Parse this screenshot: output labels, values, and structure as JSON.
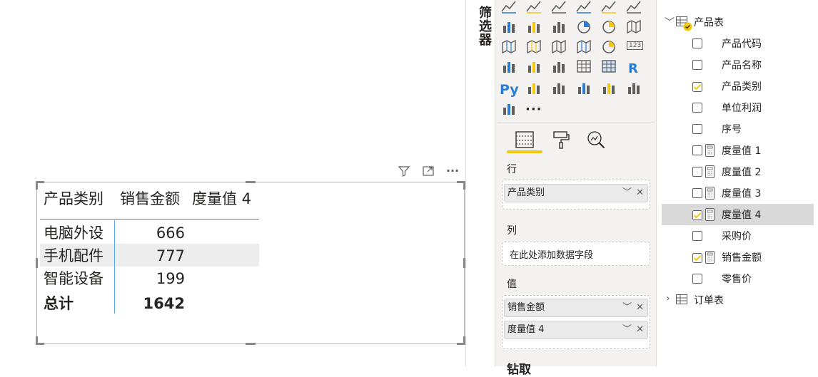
{
  "matrix": {
    "headers": [
      "产品类别",
      "销售金额",
      "度量值 4"
    ],
    "rows": [
      {
        "category": "电脑外设",
        "sales": "666"
      },
      {
        "category": "手机配件",
        "sales": "777"
      },
      {
        "category": "智能设备",
        "sales": "199"
      }
    ],
    "total": {
      "label": "总计",
      "sales": "1642"
    }
  },
  "visual_header": {
    "icons": [
      "filter-icon",
      "focus-mode-icon",
      "more-options-icon"
    ]
  },
  "filters": {
    "label": "筛选器"
  },
  "visualizations": {
    "gallery_icons": [
      "line-chart",
      "area-chart",
      "stacked-area-chart",
      "line-clustered-column-chart",
      "line-stacked-column-chart",
      "ribbon-chart",
      "waterfall-chart",
      "funnel-chart",
      "scatter-chart",
      "pie-chart",
      "donut-chart",
      "treemap",
      "map",
      "filled-map",
      "shape-map",
      "azure-map",
      "gauge",
      "card",
      "multi-row-card",
      "kpi",
      "slicer",
      "table",
      "matrix",
      "r-visual",
      "python-visual",
      "key-influencers",
      "decomposition-tree",
      "qa-visual",
      "paginated-report",
      "smart-narrative",
      "power-apps",
      "more-visuals"
    ],
    "more_label": "···",
    "r_label": "R",
    "py_label": "Py",
    "card_label": "123",
    "tabs": [
      "fields-tab-icon",
      "format-tab-icon",
      "analytics-tab-icon"
    ],
    "wells": {
      "rows_label": "行",
      "rows_field": "产品类别",
      "columns_label": "列",
      "columns_placeholder": "在此处添加数据字段",
      "values_label": "值",
      "values_fields": [
        "销售金额",
        "度量值 4"
      ],
      "drillthrough_label": "钻取"
    }
  },
  "fields": {
    "tables": [
      {
        "name": "产品表",
        "expanded": true
      },
      {
        "name": "订单表",
        "expanded": false
      }
    ],
    "product_fields": [
      {
        "label": "产品代码",
        "checked": false,
        "measure": false
      },
      {
        "label": "产品名称",
        "checked": false,
        "measure": false
      },
      {
        "label": "产品类别",
        "checked": true,
        "measure": false
      },
      {
        "label": "单位利润",
        "checked": false,
        "measure": false
      },
      {
        "label": "序号",
        "checked": false,
        "measure": false
      },
      {
        "label": "度量值 1",
        "checked": false,
        "measure": true
      },
      {
        "label": "度量值 2",
        "checked": false,
        "measure": true
      },
      {
        "label": "度量值 3",
        "checked": false,
        "measure": true
      },
      {
        "label": "度量值 4",
        "checked": true,
        "measure": true,
        "selected": true
      },
      {
        "label": "采购价",
        "checked": false,
        "measure": false
      },
      {
        "label": "销售金额",
        "checked": true,
        "measure": true
      },
      {
        "label": "零售价",
        "checked": false,
        "measure": false
      }
    ]
  },
  "colors": {
    "accent_yellow": "#f2c811",
    "accent_blue": "#118dff",
    "selection_gray": "#d9d9d9"
  }
}
